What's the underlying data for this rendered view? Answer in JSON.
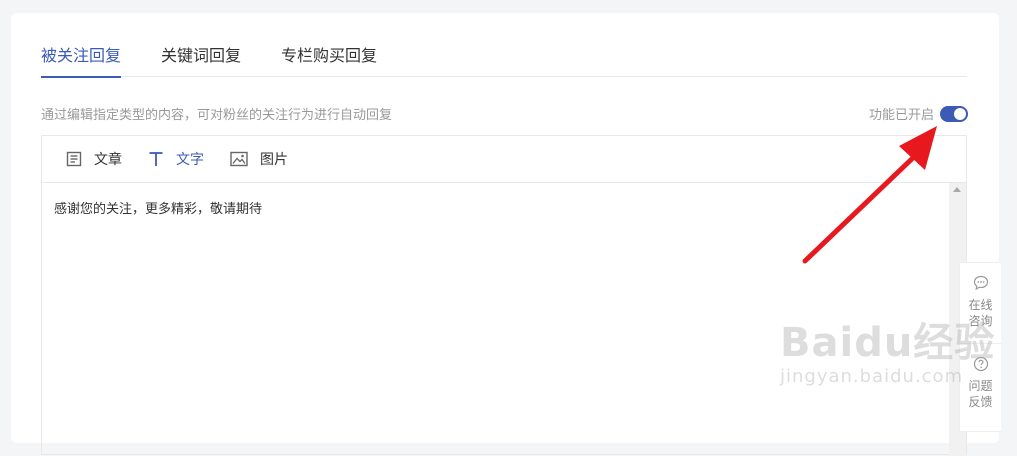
{
  "tabs": [
    {
      "label": "被关注回复",
      "active": true
    },
    {
      "label": "关键词回复",
      "active": false
    },
    {
      "label": "专栏购买回复",
      "active": false
    }
  ],
  "description": "通过编辑指定类型的内容，可对粉丝的关注行为进行自动回复",
  "feature_status": {
    "label": "功能已开启",
    "enabled": true
  },
  "toolbar": {
    "article_label": "文章",
    "text_label": "文字",
    "image_label": "图片"
  },
  "editor": {
    "content": "感谢您的关注，更多精彩，敬请期待"
  },
  "float_panel": {
    "consult_label": "在线咨询",
    "feedback_label": "问题反馈"
  },
  "watermark": {
    "main": "Baidu经验",
    "sub": "jingyan.baidu.com"
  },
  "colors": {
    "accent": "#3b5bb5",
    "arrow": "#e8181f"
  }
}
